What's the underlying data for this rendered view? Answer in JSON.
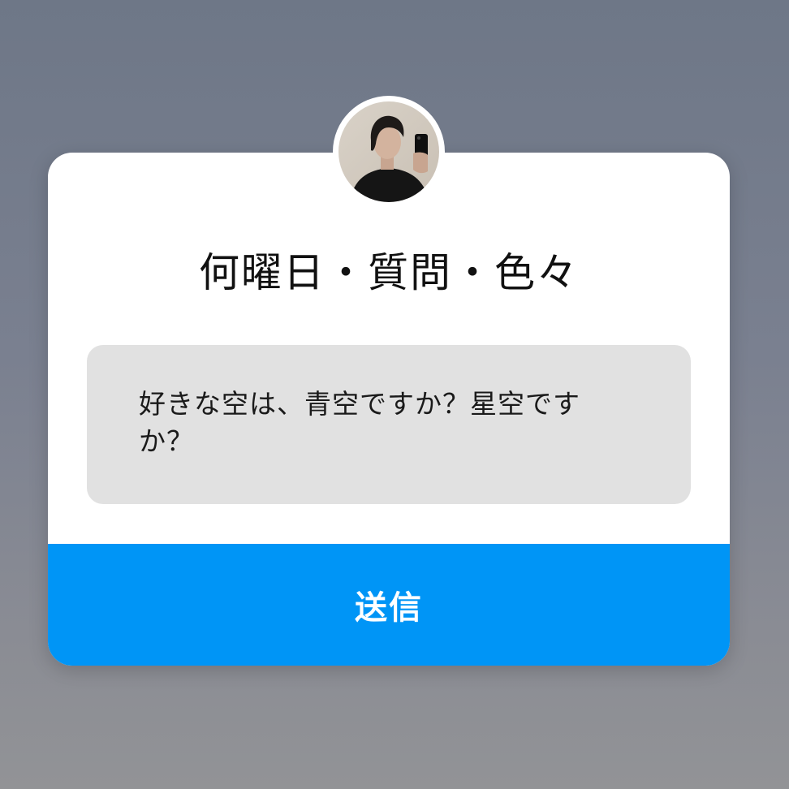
{
  "question_sticker": {
    "title": "何曜日・質問・色々",
    "answer_text": "好きな空は、青空ですか？星空ですか？",
    "send_label": "送信"
  },
  "colors": {
    "send_button": "#0095f6",
    "answer_box": "#e1e1e1",
    "card": "#ffffff"
  },
  "icons": {
    "avatar": "profile-photo-avatar"
  }
}
